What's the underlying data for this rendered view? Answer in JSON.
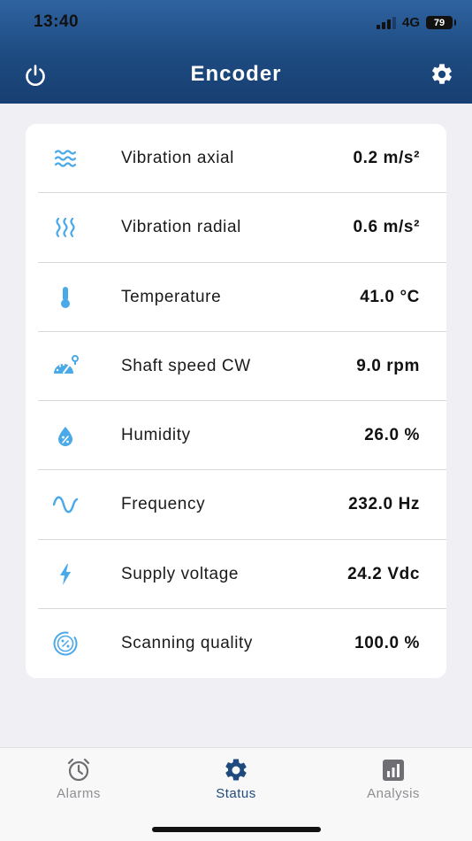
{
  "status_bar": {
    "time": "13:40",
    "network": "4G",
    "battery": "79"
  },
  "header": {
    "title": "Encoder",
    "power_icon": "power-icon",
    "settings_icon": "gear-icon"
  },
  "colors": {
    "header": "#1d4a80",
    "accent_icon": "#4aa9e8",
    "active_tab": "#1f4a7e",
    "inactive_tab": "#8e8e93"
  },
  "measurements": [
    {
      "icon": "vibration-axial-icon",
      "label": "Vibration axial",
      "value": "0.2 m/s²"
    },
    {
      "icon": "vibration-radial-icon",
      "label": "Vibration radial",
      "value": "0.6 m/s²"
    },
    {
      "icon": "thermometer-icon",
      "label": "Temperature",
      "value": "41.0 °C"
    },
    {
      "icon": "speedometer-icon",
      "label": "Shaft speed CW",
      "value": "9.0 rpm"
    },
    {
      "icon": "humidity-drop-icon",
      "label": "Humidity",
      "value": "26.0 %"
    },
    {
      "icon": "sine-wave-icon",
      "label": "Frequency",
      "value": "232.0 Hz"
    },
    {
      "icon": "lightning-icon",
      "label": "Supply voltage",
      "value": "24.2 Vdc"
    },
    {
      "icon": "percent-gauge-icon",
      "label": "Scanning quality",
      "value": "100.0 %"
    }
  ],
  "tabs": [
    {
      "icon": "alarm-clock-icon",
      "label": "Alarms",
      "active": false
    },
    {
      "icon": "gear-icon",
      "label": "Status",
      "active": true
    },
    {
      "icon": "bar-chart-icon",
      "label": "Analysis",
      "active": false
    }
  ]
}
